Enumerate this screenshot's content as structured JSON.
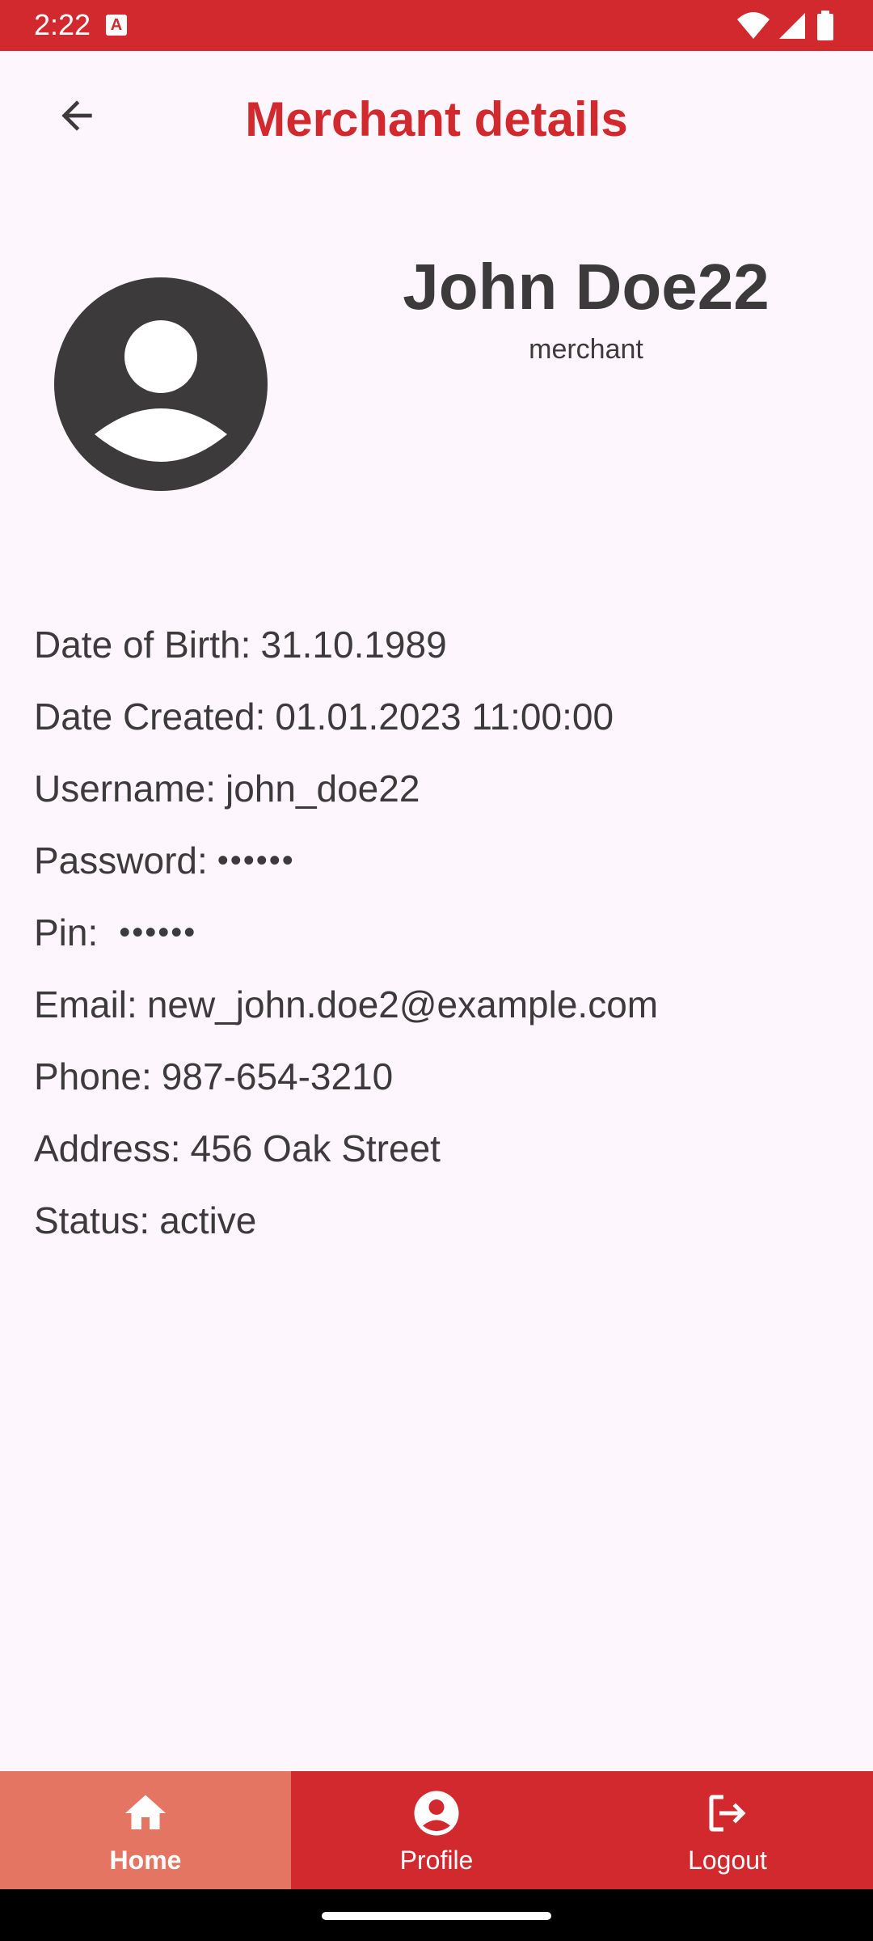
{
  "status_bar": {
    "time": "2:22",
    "icons": [
      "app-notification-icon",
      "wifi-icon",
      "signal-icon",
      "battery-icon"
    ]
  },
  "header": {
    "title": "Merchant details",
    "back_icon": "arrow-left-icon"
  },
  "profile": {
    "avatar_icon": "account-circle-icon",
    "name": "John Doe22",
    "role": "merchant"
  },
  "details": [
    {
      "label": "Date of Birth:",
      "value": "31.10.1989"
    },
    {
      "label": "Date Created:",
      "value": "01.01.2023 11:00:00"
    },
    {
      "label": "Username:",
      "value": "john_doe22"
    },
    {
      "label": "Password:",
      "value": "••••••"
    },
    {
      "label": "Pin:",
      "value": "••••••"
    },
    {
      "label": "Email:",
      "value": "new_john.doe2@example.com"
    },
    {
      "label": "Phone:",
      "value": "987-654-3210"
    },
    {
      "label": "Address:",
      "value": "456 Oak Street"
    },
    {
      "label": "Status:",
      "value": "active"
    }
  ],
  "bottom_nav": {
    "items": [
      {
        "label": "Home",
        "icon": "home-icon",
        "active": true
      },
      {
        "label": "Profile",
        "icon": "account-icon",
        "active": false
      },
      {
        "label": "Logout",
        "icon": "logout-icon",
        "active": false
      }
    ]
  },
  "colors": {
    "primary": "#d2292e",
    "nav_active": "#e57563",
    "background": "#fdf6fc",
    "text": "#3d3a3b"
  }
}
